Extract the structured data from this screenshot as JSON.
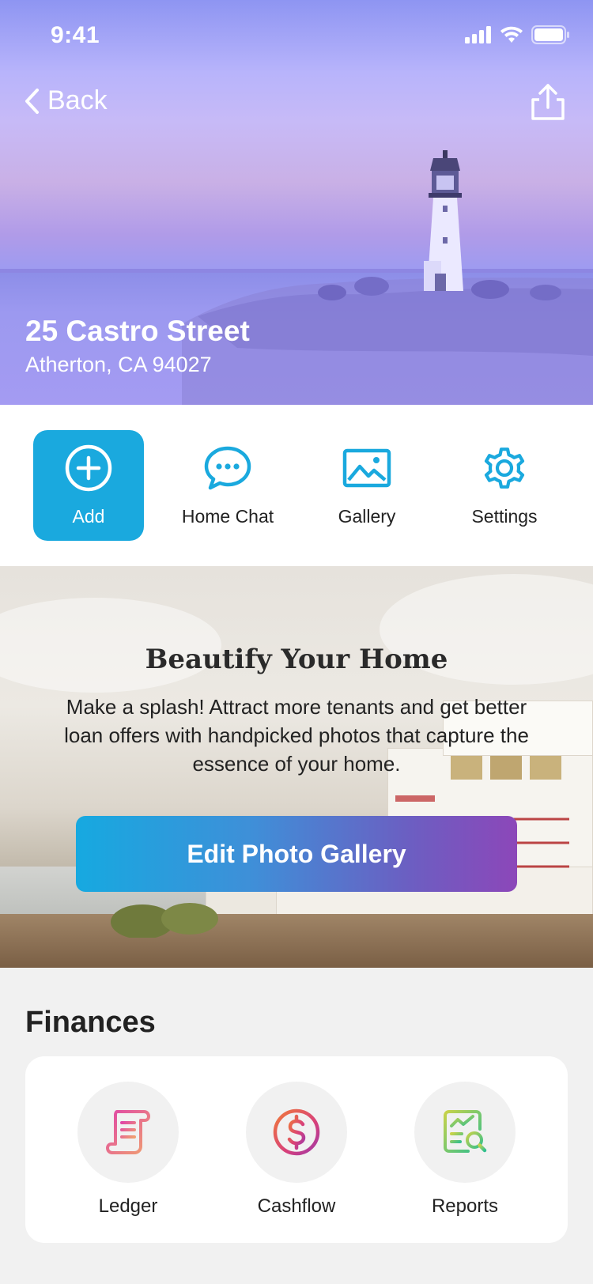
{
  "status_bar": {
    "time": "9:41"
  },
  "nav": {
    "back_label": "Back"
  },
  "property": {
    "title": "25 Castro Street",
    "address": "Atherton, CA 94027"
  },
  "actions": [
    {
      "label": "Add",
      "icon": "plus-circle-icon"
    },
    {
      "label": "Home Chat",
      "icon": "chat-bubble-icon"
    },
    {
      "label": "Gallery",
      "icon": "image-icon"
    },
    {
      "label": "Settings",
      "icon": "gear-icon"
    }
  ],
  "promo": {
    "title": "Beautify Your Home",
    "body": "Make a splash! Attract more tenants and get better loan offers with handpicked photos that capture the essence of your home.",
    "button_label": "Edit Photo Gallery"
  },
  "finances": {
    "title": "Finances",
    "items": [
      {
        "label": "Ledger",
        "icon": "scroll-ledger-icon"
      },
      {
        "label": "Cashflow",
        "icon": "dollar-circle-icon"
      },
      {
        "label": "Reports",
        "icon": "report-search-icon"
      }
    ]
  },
  "colors": {
    "accent": "#1aa9de",
    "button_gradient_start": "#16a9e0",
    "button_gradient_end": "#8c47b9",
    "hero_tint": "#9f9bf0"
  }
}
